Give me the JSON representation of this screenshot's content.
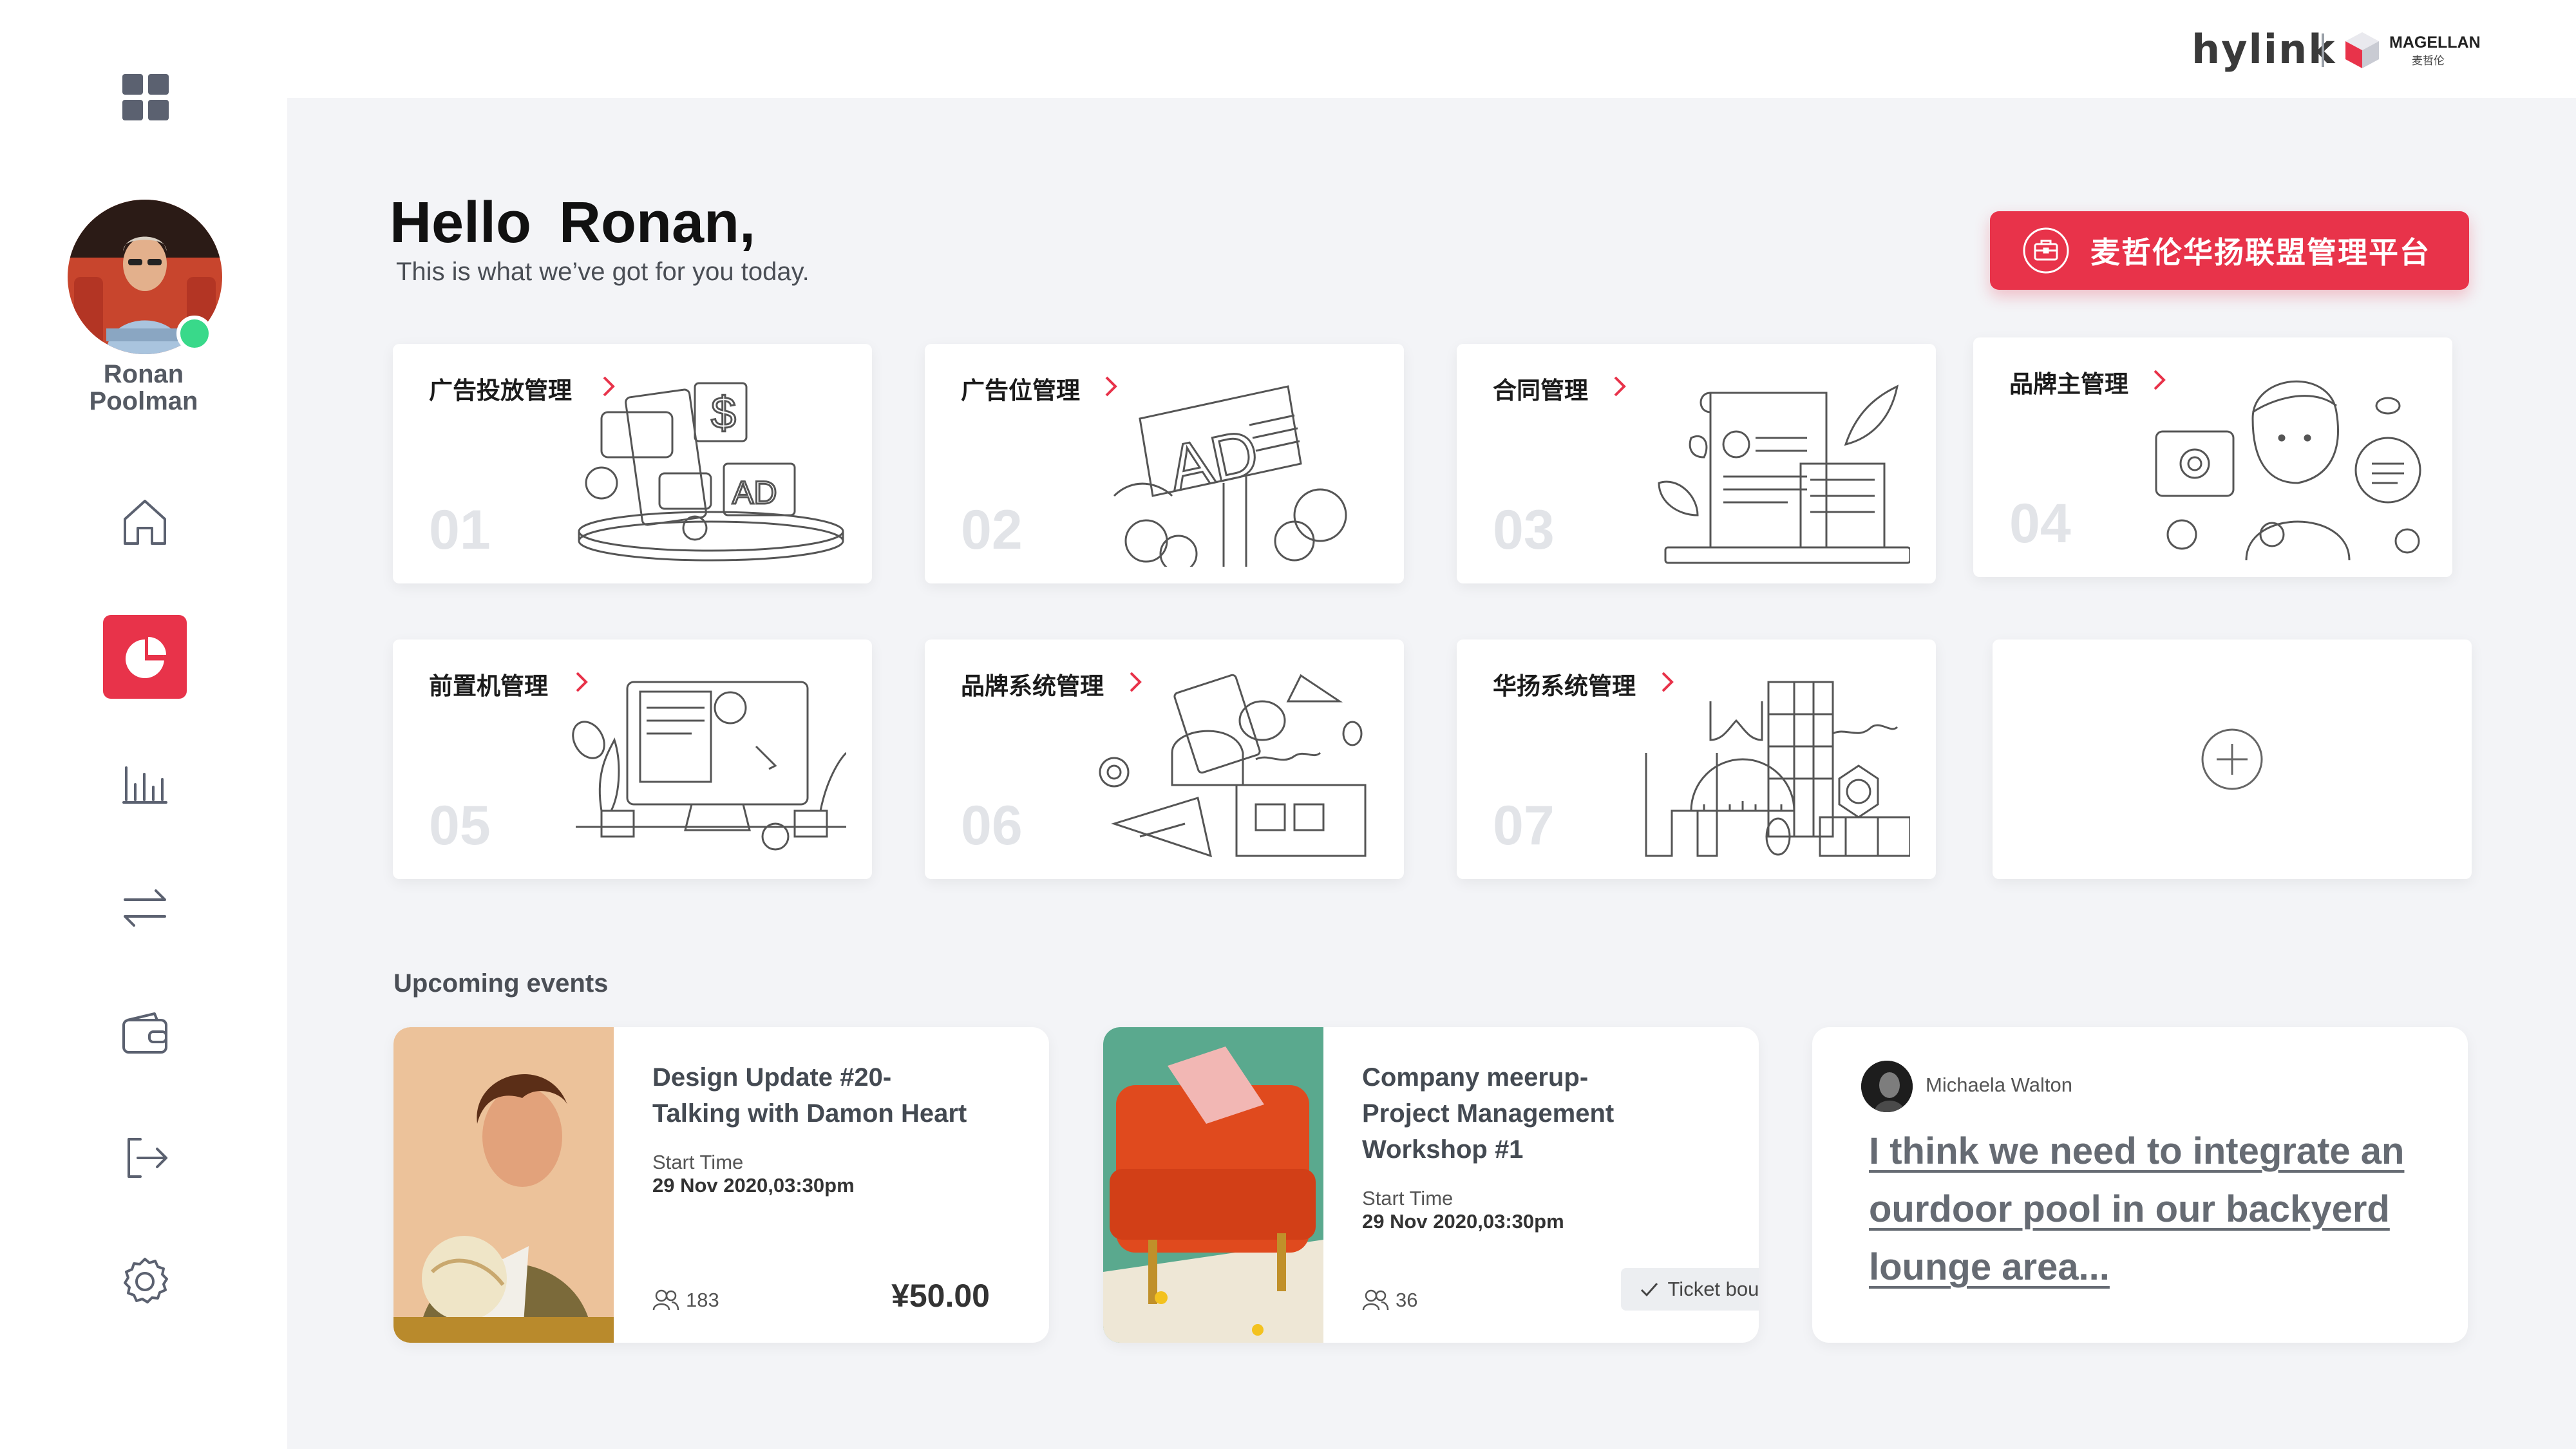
{
  "brand": {
    "hylink": "hylink",
    "magellan": "MAGELLAN",
    "magellan_sub": "麦哲伦"
  },
  "user": {
    "first_name": "Ronan",
    "last_name": "Poolman",
    "status": "online"
  },
  "greeting": {
    "title": "Hello  Ronan,",
    "subtitle": "This is what we’ve got for you today."
  },
  "cta": {
    "label": "麦哲伦华扬联盟管理平台",
    "icon": "briefcase-icon"
  },
  "nav": [
    {
      "icon": "home-icon",
      "active": false
    },
    {
      "icon": "pie-chart-icon",
      "active": true
    },
    {
      "icon": "bar-chart-icon",
      "active": false
    },
    {
      "icon": "transfer-icon",
      "active": false
    },
    {
      "icon": "wallet-icon",
      "active": false
    },
    {
      "icon": "logout-icon",
      "active": false
    },
    {
      "icon": "settings-icon",
      "active": false
    }
  ],
  "modules": [
    {
      "title": "广告投放管理",
      "num": "01"
    },
    {
      "title": "广告位管理",
      "num": "02"
    },
    {
      "title": "合同管理",
      "num": "03"
    },
    {
      "title": "品牌主管理",
      "num": "04"
    },
    {
      "title": "前置机管理",
      "num": "05"
    },
    {
      "title": "品牌系统管理",
      "num": "06"
    },
    {
      "title": "华扬系统管理",
      "num": "07"
    }
  ],
  "colors": {
    "accent": "#e8334a",
    "online": "#39d98a",
    "background": "#f3f4f7"
  },
  "events_section": {
    "title": "Upcoming events"
  },
  "events": [
    {
      "title_lines": [
        "Design Update #20-",
        "Talking with Damon Heart"
      ],
      "start_label": "Start Time",
      "start_value": "29 Nov 2020,03:30pm",
      "attendees": "183",
      "price": "¥50.00"
    },
    {
      "title_lines": [
        "Company meerup-",
        "Project Management",
        "Workshop #1"
      ],
      "start_label": "Start Time",
      "start_value": "29 Nov 2020,03:30pm",
      "attendees": "36",
      "ticket": "Ticket bought"
    }
  ],
  "comment": {
    "author": "Michaela Walton",
    "text": "I think we need to integrate an ourdoor pool in our backyerd lounge area..."
  }
}
